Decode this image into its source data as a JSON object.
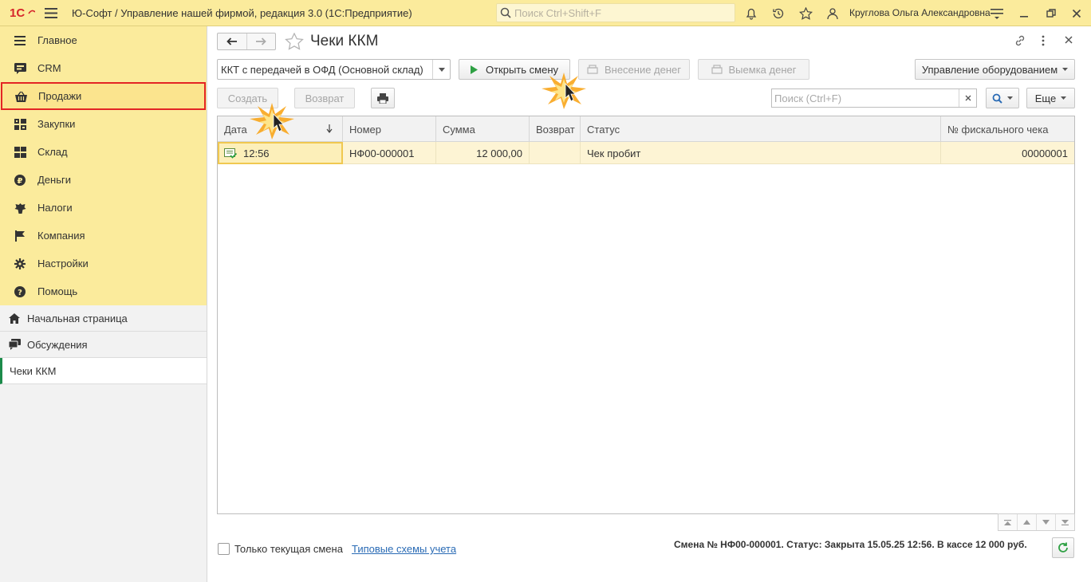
{
  "topbar": {
    "app_title": "Ю-Софт / Управление нашей фирмой, редакция 3.0  (1С:Предприятие)",
    "search_placeholder": "Поиск Ctrl+Shift+F",
    "user_name": "Круглова Ольга Александровна"
  },
  "sidebar": {
    "sections": [
      {
        "label": "Главное",
        "icon": "menu-lines-icon"
      },
      {
        "label": "CRM",
        "icon": "crm-icon"
      },
      {
        "label": "Продажи",
        "icon": "basket-icon",
        "active": true
      },
      {
        "label": "Закупки",
        "icon": "purchases-icon"
      },
      {
        "label": "Склад",
        "icon": "warehouse-icon"
      },
      {
        "label": "Деньги",
        "icon": "ruble-icon"
      },
      {
        "label": "Налоги",
        "icon": "emblem-icon"
      },
      {
        "label": "Компания",
        "icon": "flag-icon"
      },
      {
        "label": "Настройки",
        "icon": "gear-icon"
      },
      {
        "label": "Помощь",
        "icon": "help-icon"
      }
    ],
    "nav": [
      {
        "label": "Начальная страница",
        "icon": "home-icon"
      },
      {
        "label": "Обсуждения",
        "icon": "chat-icon"
      }
    ],
    "open_windows": [
      {
        "label": "Чеки ККМ"
      }
    ]
  },
  "form": {
    "title": "Чеки ККМ",
    "cash_register": "ККТ с передачей в ОФД (Основной склад)",
    "buttons": {
      "open_shift": "Открыть смену",
      "deposit": "Внесение денег",
      "withdrawal": "Выемка денег",
      "equipment": "Управление оборудованием",
      "create": "Создать",
      "return": "Возврат",
      "more": "Еще"
    },
    "search_placeholder": "Поиск (Ctrl+F)"
  },
  "table": {
    "columns": [
      "Дата",
      "Номер",
      "Сумма",
      "Возврат",
      "Статус",
      "№ фискального чека"
    ],
    "rows": [
      {
        "date": "12:56",
        "number": "НФ00-000001",
        "sum": "12 000,00",
        "return": "",
        "status": "Чек пробит",
        "fiscal": "00000001"
      }
    ]
  },
  "footer": {
    "checkbox_label": "Только текущая смена",
    "link": "Типовые схемы учета",
    "status": "Смена № НФ00-000001. Статус: Закрыта 15.05.25 12:56. В кассе 12 000 руб."
  },
  "colors": {
    "topbar_bg": "#fbeb9c",
    "accent_red": "#e32424",
    "accent_green": "#1c8b4a",
    "row_bg": "#fdf4d4"
  }
}
